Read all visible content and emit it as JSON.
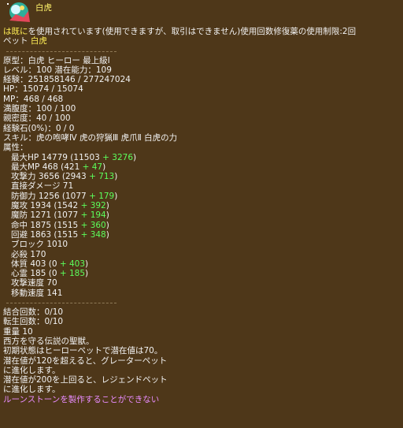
{
  "pet": {
    "name": "白虎",
    "usage_line_part1": "は既に",
    "usage_line_part2": "を使用されています(使用できますが、取引はできません)使用回数修復薬の使用制限:2回",
    "type_line_prefix": "ペット",
    "type_line_name": "白虎"
  },
  "stats": [
    "原型：白虎  ヒーロー  最上級Ⅰ",
    "レベル：100  潜在能力：109",
    "経験：251858146 / 277247024",
    "HP：15074 / 15074",
    "MP：468 / 468",
    "満腹度：100 / 100",
    "親密度：40 / 100",
    "経験石(0%)：0 / 0",
    "スキル：虎の咆哮Ⅳ  虎の狩猟Ⅲ  虎爪Ⅱ  白虎の力",
    "属性："
  ],
  "attributes": [
    {
      "label": "最大HP 14779 (11503 ",
      "bonus": "+ 3276",
      "tail": ")"
    },
    {
      "label": "最大MP 468 (421 ",
      "bonus": "+ 47",
      "tail": ")"
    },
    {
      "label": "攻撃力 3656 (2943 ",
      "bonus": "+ 713",
      "tail": ")"
    },
    {
      "label": "直接ダメージ 71",
      "bonus": "",
      "tail": ""
    },
    {
      "label": "防御力 1256 (1077 ",
      "bonus": "+ 179",
      "tail": ")"
    },
    {
      "label": "魔攻 1934 (1542 ",
      "bonus": "+ 392",
      "tail": ")"
    },
    {
      "label": "魔防 1271 (1077 ",
      "bonus": "+ 194",
      "tail": ")"
    },
    {
      "label": "命中 1875 (1515 ",
      "bonus": "+ 360",
      "tail": ")"
    },
    {
      "label": "回避 1863 (1515 ",
      "bonus": "+ 348",
      "tail": ")"
    },
    {
      "label": "ブロック 1010",
      "bonus": "",
      "tail": ""
    },
    {
      "label": "必殺 170",
      "bonus": "",
      "tail": ""
    },
    {
      "label": "体質 403 (0 ",
      "bonus": "+ 403",
      "tail": ")"
    },
    {
      "label": "心霊 185 (0 ",
      "bonus": "+ 185",
      "tail": ")"
    },
    {
      "label": "攻撃速度 70",
      "bonus": "",
      "tail": ""
    },
    {
      "label": "移動速度 141",
      "bonus": "",
      "tail": ""
    }
  ],
  "extra": [
    "結合回数：0/10",
    "転生回数：0/10",
    "重量 10",
    "西方を守る伝説の聖獣。",
    "初期状態はヒーローペットで潜在値は70。",
    "潜在値が120を超えると、グレーターペット",
    "に進化します。",
    "潜在値が200を上回ると、レジェンドペット",
    "に進化します。"
  ],
  "warning": "ルーンストーンを製作することができない",
  "colors": {
    "background": "#4e3719",
    "bonus": "#5cff5c",
    "highlight": "#ffee55",
    "warning": "#e98cff"
  },
  "icon": "white-tiger-pet-icon"
}
